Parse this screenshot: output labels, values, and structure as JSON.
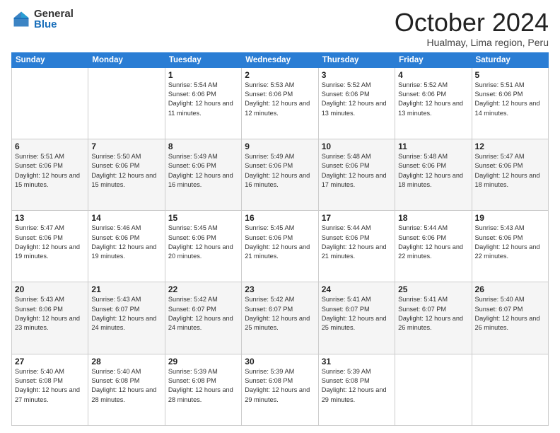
{
  "logo": {
    "general": "General",
    "blue": "Blue"
  },
  "title": "October 2024",
  "location": "Hualmay, Lima region, Peru",
  "days_of_week": [
    "Sunday",
    "Monday",
    "Tuesday",
    "Wednesday",
    "Thursday",
    "Friday",
    "Saturday"
  ],
  "weeks": [
    [
      {
        "num": "",
        "info": ""
      },
      {
        "num": "",
        "info": ""
      },
      {
        "num": "1",
        "info": "Sunrise: 5:54 AM\nSunset: 6:06 PM\nDaylight: 12 hours\nand 11 minutes."
      },
      {
        "num": "2",
        "info": "Sunrise: 5:53 AM\nSunset: 6:06 PM\nDaylight: 12 hours\nand 12 minutes."
      },
      {
        "num": "3",
        "info": "Sunrise: 5:52 AM\nSunset: 6:06 PM\nDaylight: 12 hours\nand 13 minutes."
      },
      {
        "num": "4",
        "info": "Sunrise: 5:52 AM\nSunset: 6:06 PM\nDaylight: 12 hours\nand 13 minutes."
      },
      {
        "num": "5",
        "info": "Sunrise: 5:51 AM\nSunset: 6:06 PM\nDaylight: 12 hours\nand 14 minutes."
      }
    ],
    [
      {
        "num": "6",
        "info": "Sunrise: 5:51 AM\nSunset: 6:06 PM\nDaylight: 12 hours\nand 15 minutes."
      },
      {
        "num": "7",
        "info": "Sunrise: 5:50 AM\nSunset: 6:06 PM\nDaylight: 12 hours\nand 15 minutes."
      },
      {
        "num": "8",
        "info": "Sunrise: 5:49 AM\nSunset: 6:06 PM\nDaylight: 12 hours\nand 16 minutes."
      },
      {
        "num": "9",
        "info": "Sunrise: 5:49 AM\nSunset: 6:06 PM\nDaylight: 12 hours\nand 16 minutes."
      },
      {
        "num": "10",
        "info": "Sunrise: 5:48 AM\nSunset: 6:06 PM\nDaylight: 12 hours\nand 17 minutes."
      },
      {
        "num": "11",
        "info": "Sunrise: 5:48 AM\nSunset: 6:06 PM\nDaylight: 12 hours\nand 18 minutes."
      },
      {
        "num": "12",
        "info": "Sunrise: 5:47 AM\nSunset: 6:06 PM\nDaylight: 12 hours\nand 18 minutes."
      }
    ],
    [
      {
        "num": "13",
        "info": "Sunrise: 5:47 AM\nSunset: 6:06 PM\nDaylight: 12 hours\nand 19 minutes."
      },
      {
        "num": "14",
        "info": "Sunrise: 5:46 AM\nSunset: 6:06 PM\nDaylight: 12 hours\nand 19 minutes."
      },
      {
        "num": "15",
        "info": "Sunrise: 5:45 AM\nSunset: 6:06 PM\nDaylight: 12 hours\nand 20 minutes."
      },
      {
        "num": "16",
        "info": "Sunrise: 5:45 AM\nSunset: 6:06 PM\nDaylight: 12 hours\nand 21 minutes."
      },
      {
        "num": "17",
        "info": "Sunrise: 5:44 AM\nSunset: 6:06 PM\nDaylight: 12 hours\nand 21 minutes."
      },
      {
        "num": "18",
        "info": "Sunrise: 5:44 AM\nSunset: 6:06 PM\nDaylight: 12 hours\nand 22 minutes."
      },
      {
        "num": "19",
        "info": "Sunrise: 5:43 AM\nSunset: 6:06 PM\nDaylight: 12 hours\nand 22 minutes."
      }
    ],
    [
      {
        "num": "20",
        "info": "Sunrise: 5:43 AM\nSunset: 6:06 PM\nDaylight: 12 hours\nand 23 minutes."
      },
      {
        "num": "21",
        "info": "Sunrise: 5:43 AM\nSunset: 6:07 PM\nDaylight: 12 hours\nand 24 minutes."
      },
      {
        "num": "22",
        "info": "Sunrise: 5:42 AM\nSunset: 6:07 PM\nDaylight: 12 hours\nand 24 minutes."
      },
      {
        "num": "23",
        "info": "Sunrise: 5:42 AM\nSunset: 6:07 PM\nDaylight: 12 hours\nand 25 minutes."
      },
      {
        "num": "24",
        "info": "Sunrise: 5:41 AM\nSunset: 6:07 PM\nDaylight: 12 hours\nand 25 minutes."
      },
      {
        "num": "25",
        "info": "Sunrise: 5:41 AM\nSunset: 6:07 PM\nDaylight: 12 hours\nand 26 minutes."
      },
      {
        "num": "26",
        "info": "Sunrise: 5:40 AM\nSunset: 6:07 PM\nDaylight: 12 hours\nand 26 minutes."
      }
    ],
    [
      {
        "num": "27",
        "info": "Sunrise: 5:40 AM\nSunset: 6:08 PM\nDaylight: 12 hours\nand 27 minutes."
      },
      {
        "num": "28",
        "info": "Sunrise: 5:40 AM\nSunset: 6:08 PM\nDaylight: 12 hours\nand 28 minutes."
      },
      {
        "num": "29",
        "info": "Sunrise: 5:39 AM\nSunset: 6:08 PM\nDaylight: 12 hours\nand 28 minutes."
      },
      {
        "num": "30",
        "info": "Sunrise: 5:39 AM\nSunset: 6:08 PM\nDaylight: 12 hours\nand 29 minutes."
      },
      {
        "num": "31",
        "info": "Sunrise: 5:39 AM\nSunset: 6:08 PM\nDaylight: 12 hours\nand 29 minutes."
      },
      {
        "num": "",
        "info": ""
      },
      {
        "num": "",
        "info": ""
      }
    ]
  ]
}
